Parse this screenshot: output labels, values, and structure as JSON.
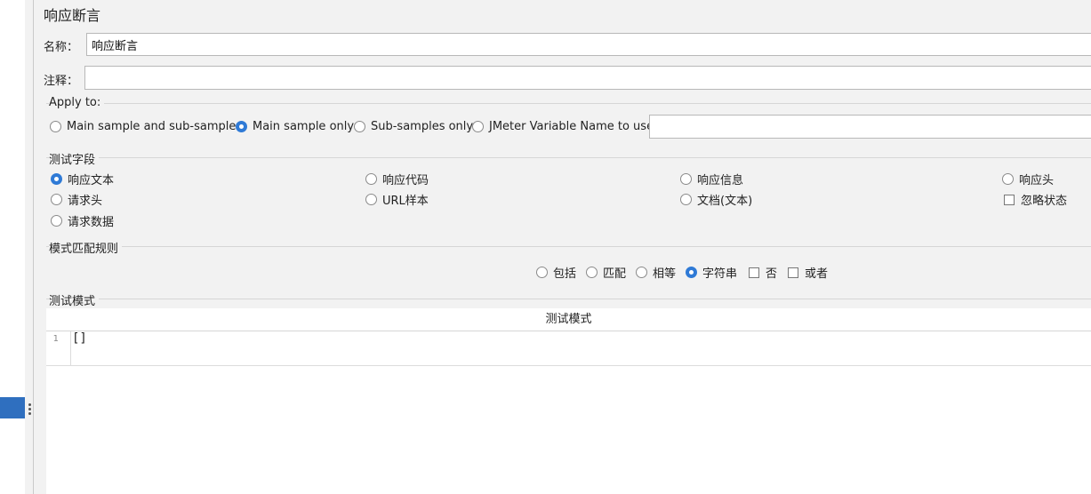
{
  "title": "响应断言",
  "name_label": "名称：",
  "name_value": "响应断言",
  "comment_label": "注释：",
  "comment_value": "",
  "apply_to": {
    "title": "Apply to:",
    "options": [
      "Main sample and sub-samples",
      "Main sample only",
      "Sub-samples only",
      "JMeter Variable Name to use"
    ],
    "selected": "Main sample only",
    "variable_value": ""
  },
  "test_field": {
    "title": "测试字段",
    "options": [
      "响应文本",
      "响应代码",
      "响应信息",
      "响应头",
      "请求头",
      "URL样本",
      "文档(文本)",
      "请求数据"
    ],
    "selected": "响应文本",
    "ignore_status_label": "忽略状态",
    "ignore_status_checked": false
  },
  "pattern_rule": {
    "title": "模式匹配规则",
    "options": [
      "包括",
      "匹配",
      "相等",
      "字符串"
    ],
    "selected": "字符串",
    "not_label": "否",
    "or_label": "或者"
  },
  "test_pattern": {
    "title": "测试模式",
    "column_header": "测试模式",
    "lines": [
      {
        "number": "1",
        "text": "[]"
      }
    ]
  },
  "colors": {
    "accent": "#2f7ad6",
    "selection": "#2f6fbf"
  }
}
